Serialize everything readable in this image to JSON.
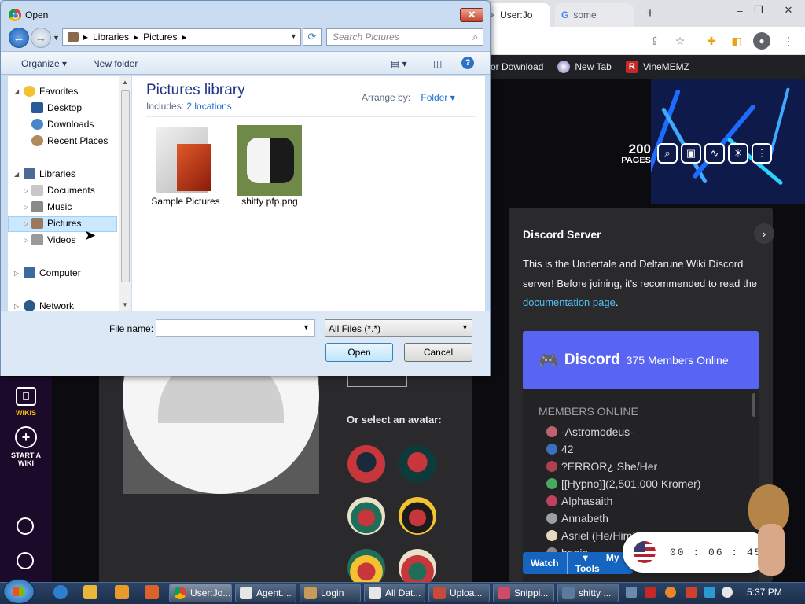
{
  "browser": {
    "tabs": [
      {
        "label": "User:Jo"
      },
      {
        "label": "some"
      }
    ],
    "new_tab_symbol": "+",
    "window_controls": {
      "minimize": "–",
      "restore": "❐",
      "close": "✕"
    },
    "bookmarks": [
      {
        "label": "or Download",
        "icon": "download-icon"
      },
      {
        "label": "New Tab",
        "icon": "newtab-icon"
      },
      {
        "label": "VineMEMZ",
        "icon": "vinememz-icon"
      }
    ]
  },
  "wiki": {
    "page_count": "200",
    "page_count_label": "PAGES",
    "rail": [
      {
        "label": "WIKIS"
      },
      {
        "label": "START A WIKI"
      }
    ],
    "select_avatar_label": "Or select an avatar:",
    "discord": {
      "title": "Discord Server",
      "description_1": "This is the Undertale and Deltarune Wiki Discord server! Before joining, it's recommended to read the ",
      "description_link": "documentation page",
      "description_end": ".",
      "logo_text": "Discord",
      "online_count": "375 Members Online",
      "members_title": "MEMBERS ONLINE",
      "members": [
        {
          "name": "-Astromodeus-",
          "color": "#c06070"
        },
        {
          "name": "42",
          "color": "#3c6fc0"
        },
        {
          "name": "?ERROR¿ She/Her",
          "color": "#b04050"
        },
        {
          "name": "[[Hypno]](2,501,000 Kromer)",
          "color": "#4aa860"
        },
        {
          "name": "Alphasaith",
          "color": "#c04060"
        },
        {
          "name": "Annabeth",
          "color": "#9aa0a6"
        },
        {
          "name": "Asriel (He/Him)",
          "color": "#e8d8c0"
        },
        {
          "name": "banio",
          "color": "#888888"
        }
      ]
    },
    "watch_label": "Watch",
    "my_tools_label": "My Tools",
    "timer": "00 : 06 : 45"
  },
  "dialog": {
    "title": "Open",
    "close_symbol": "✕",
    "breadcrumb": [
      "Libraries",
      "Pictures"
    ],
    "search_placeholder": "Search Pictures",
    "organize_label": "Organize ▾",
    "new_folder_label": "New folder",
    "nav": {
      "favorites": "Favorites",
      "desktop": "Desktop",
      "downloads": "Downloads",
      "recent": "Recent Places",
      "libraries": "Libraries",
      "documents": "Documents",
      "music": "Music",
      "pictures": "Pictures",
      "videos": "Videos",
      "computer": "Computer",
      "network": "Network"
    },
    "library_title": "Pictures library",
    "includes_label": "Includes:",
    "includes_link": "2 locations",
    "arrange_label": "Arrange by:",
    "arrange_value": "Folder ▾",
    "files": [
      {
        "name": "Sample Pictures"
      },
      {
        "name": "shitty pfp.png"
      }
    ],
    "filename_label": "File name:",
    "filename_value": "",
    "filetype_value": "All Files (*.*)",
    "open_label": "Open",
    "cancel_label": "Cancel"
  },
  "taskbar": {
    "tasks": [
      {
        "label": "User:Jo..."
      },
      {
        "label": "Agent...."
      },
      {
        "label": "Login"
      },
      {
        "label": "All Dat..."
      },
      {
        "label": "Uploa..."
      },
      {
        "label": "Snippi..."
      },
      {
        "label": "shitty ..."
      }
    ],
    "clock": "5:37 PM"
  }
}
